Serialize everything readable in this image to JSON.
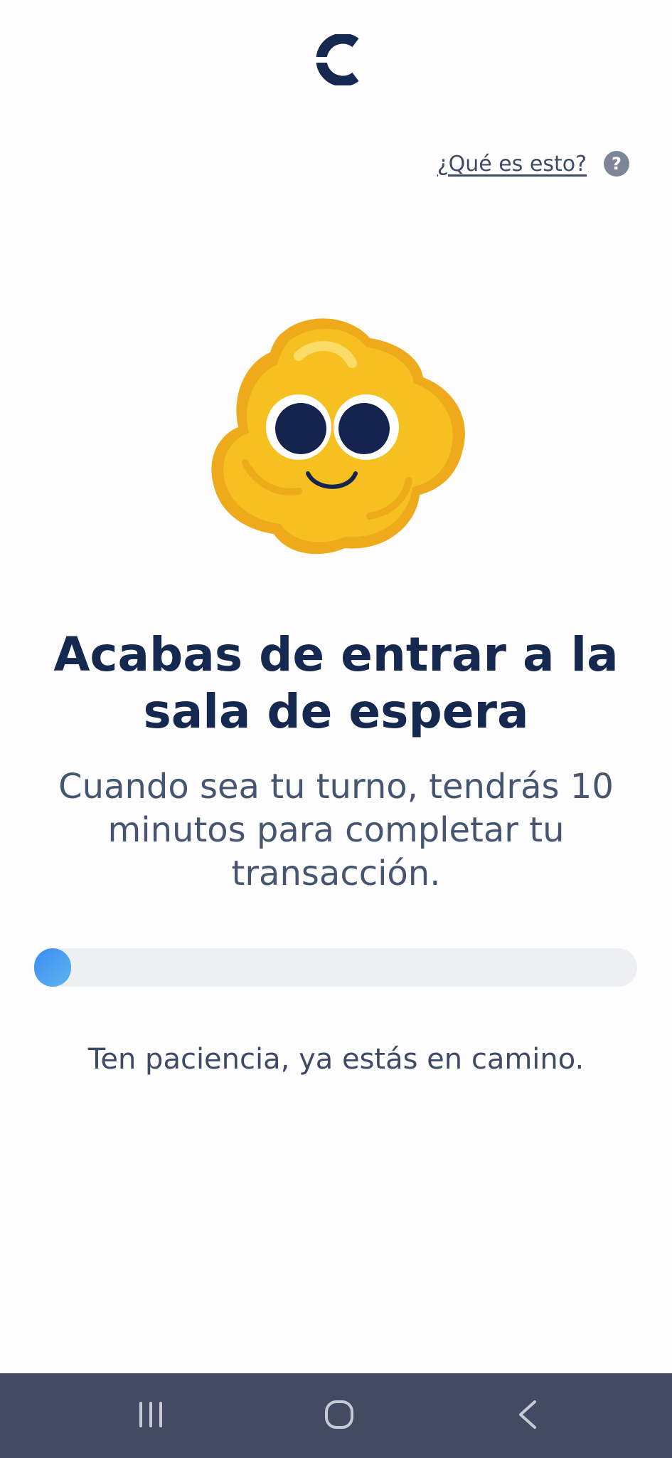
{
  "header": {
    "logo_icon": "cabify-logo-icon"
  },
  "help": {
    "link_label": "¿Qué es esto?",
    "icon_glyph": "?"
  },
  "mascot": {
    "icon": "smiling-yellow-blob-mascot"
  },
  "content": {
    "title": "Acabas de entrar a la sala de espera",
    "subtitle": "Cuando sea tu turno, tendrás 10 minutos para completar tu transacción.",
    "progress_fraction": 0.03,
    "hint": "Ten paciencia, ya estás en camino."
  },
  "navigation": {
    "recent_icon": "recent-apps-icon",
    "home_icon": "home-icon",
    "back_icon": "back-icon"
  },
  "colors": {
    "title": "#15284f",
    "text": "#465570",
    "navbar": "#434b62",
    "progress_track": "#eeeff3",
    "progress_fill": "#3d8bf2",
    "mascot": "#f2b51e"
  }
}
